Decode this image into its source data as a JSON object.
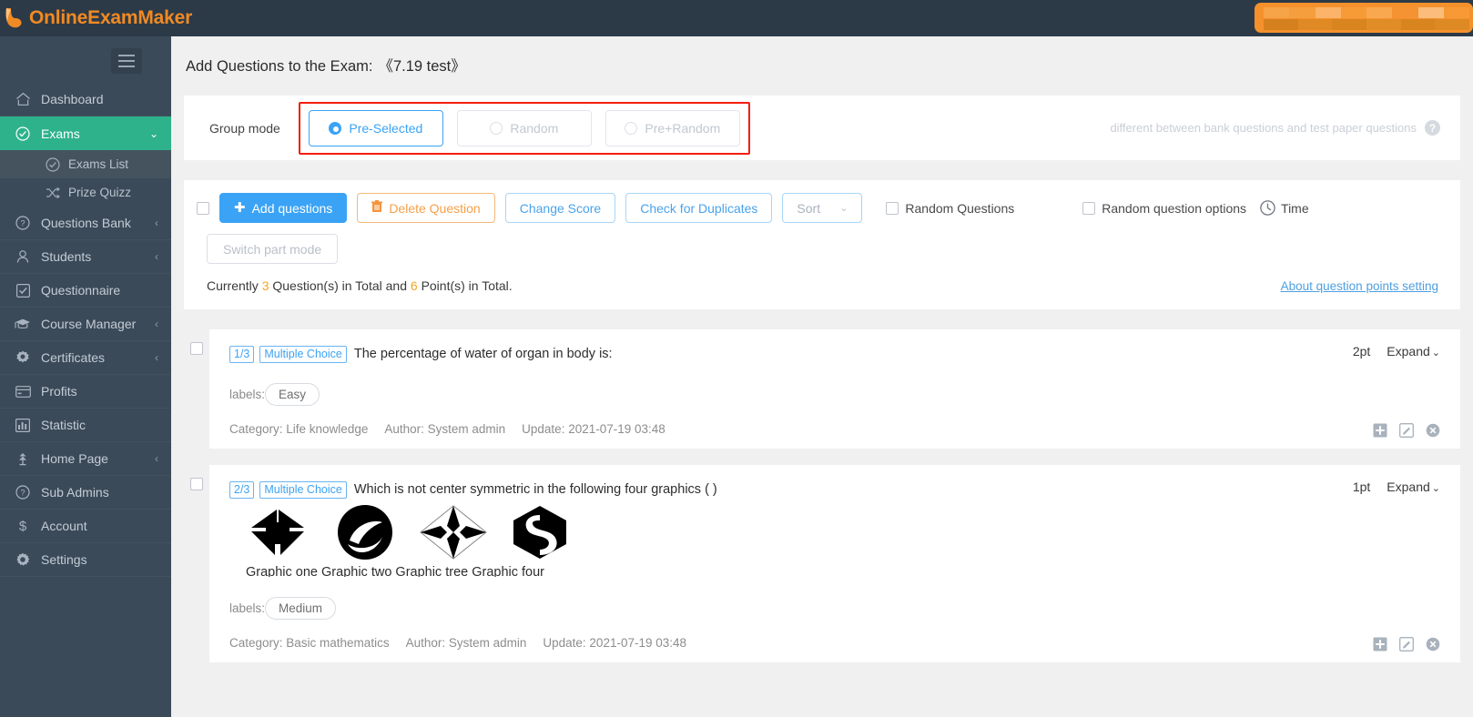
{
  "app": {
    "brand": "OnlineExamMaker",
    "logo_icon": "flame-logo-icon"
  },
  "sidebar": {
    "menu_toggle_icon": "hamburger-icon",
    "items": [
      {
        "label": "Dashboard",
        "icon": "home-icon",
        "arrow": "",
        "active": false,
        "sub": false
      },
      {
        "label": "Exams",
        "icon": "check-circle-icon",
        "arrow": "⌄",
        "active": true,
        "sub": false
      },
      {
        "label": "Exams List",
        "icon": "check-circle-icon",
        "arrow": "",
        "active": false,
        "sub": true,
        "selected": true
      },
      {
        "label": "Prize Quizz",
        "icon": "shuffle-icon",
        "arrow": "",
        "active": false,
        "sub": true,
        "selected": false
      },
      {
        "label": "Questions Bank",
        "icon": "question-icon",
        "arrow": "‹",
        "active": false,
        "sub": false
      },
      {
        "label": "Students",
        "icon": "user-icon",
        "arrow": "‹",
        "active": false,
        "sub": false
      },
      {
        "label": "Questionnaire",
        "icon": "checkbox-icon",
        "arrow": "",
        "active": false,
        "sub": false
      },
      {
        "label": "Course Manager",
        "icon": "graduation-icon",
        "arrow": "‹",
        "active": false,
        "sub": false
      },
      {
        "label": "Certificates",
        "icon": "badge-icon",
        "arrow": "‹",
        "active": false,
        "sub": false
      },
      {
        "label": "Profits",
        "icon": "card-icon",
        "arrow": "",
        "active": false,
        "sub": false
      },
      {
        "label": "Statistic",
        "icon": "bar-chart-icon",
        "arrow": "",
        "active": false,
        "sub": false
      },
      {
        "label": "Home Page",
        "icon": "plant-icon",
        "arrow": "‹",
        "active": false,
        "sub": false
      },
      {
        "label": "Sub Admins",
        "icon": "question-icon",
        "arrow": "",
        "active": false,
        "sub": false
      },
      {
        "label": "Account",
        "icon": "dollar-icon",
        "arrow": "",
        "active": false,
        "sub": false
      },
      {
        "label": "Settings",
        "icon": "gear-icon",
        "arrow": "",
        "active": false,
        "sub": false
      }
    ]
  },
  "page": {
    "title": "Add Questions to the Exam:",
    "exam_name": "《7.19 test》"
  },
  "group_mode": {
    "label": "Group mode",
    "options": [
      {
        "label": "Pre-Selected",
        "selected": true
      },
      {
        "label": "Random",
        "selected": false
      },
      {
        "label": "Pre+Random",
        "selected": false
      }
    ],
    "hint": "different between bank questions and test paper questions",
    "help_icon": "question-mark-icon",
    "highlight_color": "#f41d0e"
  },
  "toolbar": {
    "select_all_checkbox": false,
    "add_questions": "Add questions",
    "add_icon": "plus-icon",
    "delete_question": "Delete Question",
    "delete_icon": "trash-icon",
    "change_score": "Change Score",
    "check_duplicates": "Check for Duplicates",
    "sort": "Sort",
    "sort_caret_icon": "chevron-down-icon",
    "random_questions": "Random Questions",
    "random_questions_checked": false,
    "random_question_options": "Random question options",
    "random_question_options_checked": false,
    "time": "Time",
    "time_icon": "clock-icon",
    "switch_part_mode": "Switch part mode",
    "summary_prefix": "Currently",
    "summary_count": "3",
    "summary_mid": "Question(s) in Total and",
    "summary_points": "6",
    "summary_suffix": "Point(s) in Total.",
    "about_link": "About question points setting"
  },
  "questions": [
    {
      "checked": false,
      "index": "1/3",
      "type": "Multiple Choice",
      "text": "The percentage of water of organ in body is:",
      "points": "2pt",
      "expand": "Expand",
      "expand_icon": "chevron-down-icon",
      "labels_prefix": "labels:",
      "tag": "Easy",
      "category": "Category: Life knowledge",
      "author": "Author: System admin",
      "update": "Update: 2021-07-19 03:48",
      "has_graphics": false,
      "actions": [
        "add-icon",
        "edit-icon",
        "remove-icon"
      ]
    },
    {
      "checked": false,
      "index": "2/3",
      "type": "Multiple Choice",
      "text": "Which is not center symmetric in the following four graphics ( )",
      "points": "1pt",
      "expand": "Expand",
      "expand_icon": "chevron-down-icon",
      "labels_prefix": "labels:",
      "tag": "Medium",
      "category": "Category: Basic mathematics",
      "author": "Author: System admin",
      "update": "Update: 2021-07-19 03:48",
      "has_graphics": true,
      "graphics_caption": "Graphic one Graphic two Graphic tree Graphic four",
      "actions": [
        "add-icon",
        "edit-icon",
        "remove-icon"
      ]
    }
  ]
}
